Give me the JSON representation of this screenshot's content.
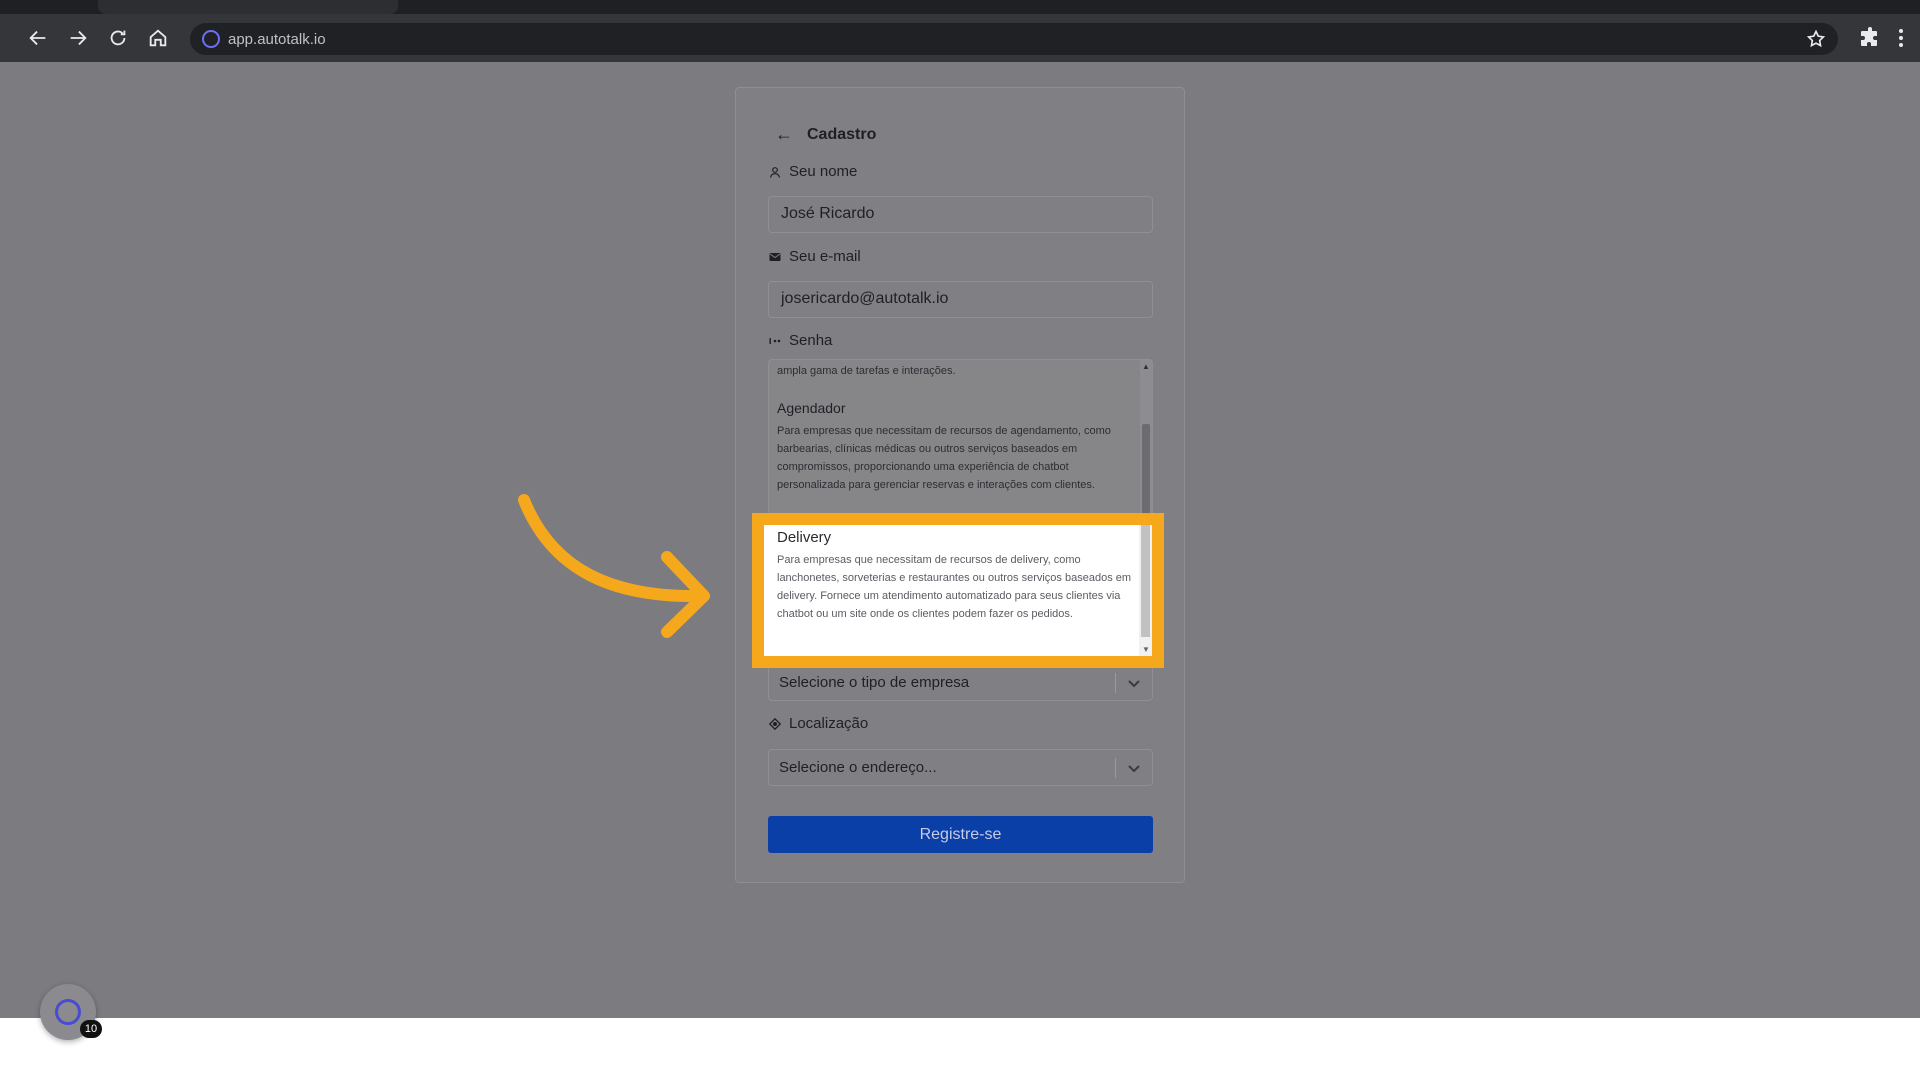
{
  "browser": {
    "url": "app.autotalk.io"
  },
  "form": {
    "title": "Cadastro",
    "name_label": "Seu nome",
    "name_value": "José Ricardo",
    "email_label": "Seu e-mail",
    "email_value": "josericardo@autotalk.io",
    "password_label": "Senha",
    "company_type_placeholder": "Selecione o tipo de empresa",
    "location_label": "Localização",
    "location_placeholder": "Selecione o endereço...",
    "register_label": "Registre-se"
  },
  "dropdown": {
    "partial_text": "ampla gama de tarefas e interações.",
    "options": [
      {
        "title": "Agendador",
        "desc": "Para empresas que necessitam de recursos de agendamento, como barbearias, clínicas médicas ou outros serviços baseados em compromissos, proporcionando uma experiência de chatbot personalizada para gerenciar reservas e interações com clientes."
      },
      {
        "title": "Delivery",
        "desc": "Para empresas que necessitam de recursos de delivery, como lanchonetes, sorveterias e restaurantes ou outros serviços baseados em delivery. Fornece um atendimento automatizado para seus clientes via chatbot ou um site onde os clientes podem fazer os pedidos."
      }
    ]
  },
  "widget": {
    "badge_count": "10"
  },
  "colors": {
    "highlight": "#f6a81c",
    "register_button": "#0b3fa8",
    "overlay": "#7b7b80"
  }
}
